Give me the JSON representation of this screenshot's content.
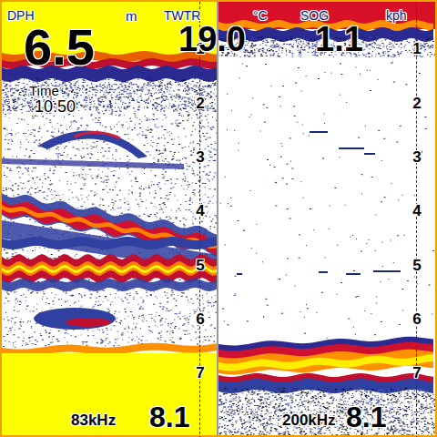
{
  "depth": {
    "label": "DPH",
    "value": "6.5",
    "unit": "m"
  },
  "time": {
    "label": "Time",
    "value": "10:50"
  },
  "water_temp": {
    "label": "TWTR",
    "value": "19.0",
    "unit": "°C"
  },
  "speed": {
    "label": "SOG",
    "value": "1.1",
    "unit": "kph"
  },
  "panels": [
    {
      "frequency": "83kHz",
      "range": "8.1",
      "scale": [
        "1",
        "2",
        "3",
        "4",
        "5",
        "6",
        "7"
      ]
    },
    {
      "frequency": "200kHz",
      "range": "8.1",
      "scale": [
        "1",
        "2",
        "3",
        "4",
        "5",
        "6",
        "7"
      ]
    }
  ]
}
